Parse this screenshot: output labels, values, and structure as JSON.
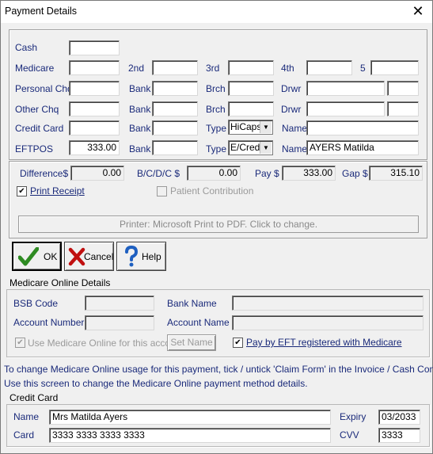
{
  "window": {
    "title": "Payment Details",
    "close": "✕"
  },
  "rows": {
    "cash": {
      "label": "Cash",
      "value": ""
    },
    "medicare": {
      "label": "Medicare",
      "value": "",
      "l2": "2nd",
      "v2": "",
      "l3": "3rd",
      "v3": "",
      "l4": "4th",
      "v4": "",
      "l5": "5",
      "v5": ""
    },
    "personal": {
      "label": "Personal Chq",
      "value": "",
      "bank_label": "Bank",
      "bank": "",
      "brch_label": "Brch",
      "brch": "",
      "drwr_label": "Drwr",
      "drwr": "",
      "drwr2": ""
    },
    "other": {
      "label": "Other Chq",
      "value": "",
      "bank_label": "Bank",
      "bank": "",
      "brch_label": "Brch",
      "brch": "",
      "drwr_label": "Drwr",
      "drwr": "",
      "drwr2": ""
    },
    "credit": {
      "label": "Credit Card",
      "value": "",
      "bank_label": "Bank",
      "bank": "",
      "type_label": "Type",
      "type": "HiCaps",
      "name_label": "Name",
      "name": ""
    },
    "eftpos": {
      "label": "EFTPOS",
      "value": "333.00",
      "bank_label": "Bank",
      "bank": "",
      "type_label": "Type",
      "type": "E/Cred",
      "name_label": "Name",
      "name": "AYERS Matilda"
    }
  },
  "totals": {
    "difference_label": "Difference$",
    "difference": "0.00",
    "bdc_label": "B/C/D/C $",
    "bdc": "0.00",
    "pay_label": "Pay $",
    "pay": "333.00",
    "gap_label": "Gap $",
    "gap": "315.10"
  },
  "options": {
    "print_receipt": "Print Receipt",
    "print_receipt_checked": true,
    "patient_contribution": "Patient Contribution",
    "patient_contribution_checked": false
  },
  "printer": "Printer: Microsoft Print to PDF. Click to change.",
  "buttons": {
    "ok": "OK",
    "cancel": "Cancel",
    "help": "Help"
  },
  "medicare_online": {
    "title": "Medicare Online Details",
    "bsb_label": "BSB Code",
    "bsb": "",
    "bank_name_label": "Bank Name",
    "bank_name": "",
    "account_number_label": "Account Number",
    "account_number": "",
    "account_name_label": "Account Name",
    "account_name": "",
    "use_online": "Use Medicare Online for this accour",
    "use_online_checked": true,
    "set_name": "Set Name",
    "pay_eft": "Pay by EFT registered with Medicare",
    "pay_eft_checked": true
  },
  "info": {
    "line1": "To change Medicare Online usage for this payment, tick / untick 'Claim Form' in the Invoice / Cash Consult",
    "line2": "Use this screen to change the Medicare Online payment method details."
  },
  "credit_card": {
    "title": "Credit Card",
    "name_label": "Name",
    "name": "Mrs Matilda Ayers",
    "expiry_label": "Expiry",
    "expiry": "03/2033",
    "card_label": "Card",
    "card": "3333 3333 3333 3333",
    "cvv_label": "CVV",
    "cvv": "3333"
  },
  "colors": {
    "label": "#1a2a7a",
    "ok_check": "#2e8b22",
    "cancel_x": "#c01010",
    "help_q": "#1e5fc0"
  },
  "icons": [
    "close-icon",
    "checkmark-icon",
    "cross-icon",
    "question-icon",
    "dropdown-arrow-icon"
  ]
}
